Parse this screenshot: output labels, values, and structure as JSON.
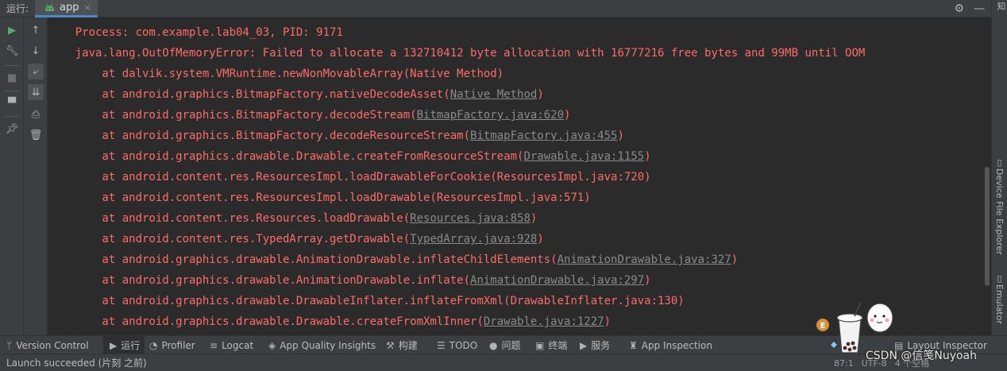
{
  "header": {
    "run_label": "运行:",
    "tab": {
      "label": "app",
      "close": "×"
    },
    "settings_icon": "gear-icon",
    "minimize_icon": "minimize-icon"
  },
  "right_strip": {
    "top_text": "知",
    "device_file_explorer": "Device File Explorer",
    "emulator": "Emulator"
  },
  "toolbar_icons": [
    "run-icon",
    "wrench-icon",
    "stop-icon",
    "layout-icon",
    "pin-icon",
    "up-arrow-icon",
    "down-arrow-icon",
    "soft-wrap-icon",
    "scroll-to-end-icon",
    "print-icon",
    "trash-icon"
  ],
  "console": {
    "lines": [
      {
        "indent": "    ",
        "text": "Process: com.example.lab04_03, PID: 9171",
        "link": "",
        "suffix": ""
      },
      {
        "indent": "    ",
        "text": "java.lang.OutOfMemoryError: Failed to allocate a 132710412 byte allocation with 16777216 free bytes and 99MB until OOM",
        "link": "",
        "suffix": ""
      },
      {
        "indent": "        ",
        "text": "at dalvik.system.VMRuntime.newNonMovableArray(Native Method)",
        "link": "",
        "suffix": ""
      },
      {
        "indent": "        ",
        "text": "at android.graphics.BitmapFactory.nativeDecodeAsset(",
        "link": "Native Method",
        "suffix": ")"
      },
      {
        "indent": "        ",
        "text": "at android.graphics.BitmapFactory.decodeStream(",
        "link": "BitmapFactory.java:620",
        "suffix": ")"
      },
      {
        "indent": "        ",
        "text": "at android.graphics.BitmapFactory.decodeResourceStream(",
        "link": "BitmapFactory.java:455",
        "suffix": ")"
      },
      {
        "indent": "        ",
        "text": "at android.graphics.drawable.Drawable.createFromResourceStream(",
        "link": "Drawable.java:1155",
        "suffix": ")"
      },
      {
        "indent": "        ",
        "text": "at android.content.res.ResourcesImpl.loadDrawableForCookie(ResourcesImpl.java:720)",
        "link": "",
        "suffix": ""
      },
      {
        "indent": "        ",
        "text": "at android.content.res.ResourcesImpl.loadDrawable(ResourcesImpl.java:571)",
        "link": "",
        "suffix": ""
      },
      {
        "indent": "        ",
        "text": "at android.content.res.Resources.loadDrawable(",
        "link": "Resources.java:858",
        "suffix": ")"
      },
      {
        "indent": "        ",
        "text": "at android.content.res.TypedArray.getDrawable(",
        "link": "TypedArray.java:928",
        "suffix": ")"
      },
      {
        "indent": "        ",
        "text": "at android.graphics.drawable.AnimationDrawable.inflateChildElements(",
        "link": "AnimationDrawable.java:327",
        "suffix": ")"
      },
      {
        "indent": "        ",
        "text": "at android.graphics.drawable.AnimationDrawable.inflate(",
        "link": "AnimationDrawable.java:297",
        "suffix": ")"
      },
      {
        "indent": "        ",
        "text": "at android.graphics.drawable.DrawableInflater.inflateFromXml(DrawableInflater.java:130)",
        "link": "",
        "suffix": ""
      },
      {
        "indent": "        ",
        "text": "at android.graphics.drawable.Drawable.createFromXmlInner(",
        "link": "Drawable.java:1227",
        "suffix": ")"
      }
    ]
  },
  "bottom_tools": [
    {
      "icon": "version-control-icon",
      "glyph": "ᛘ",
      "label": "Version Control",
      "active": false
    },
    {
      "icon": "run-icon",
      "glyph": "▶",
      "label": "运行",
      "active": true
    },
    {
      "icon": "profiler-icon",
      "glyph": "◔",
      "label": "Profiler",
      "active": false
    },
    {
      "icon": "logcat-icon",
      "glyph": "≡",
      "label": "Logcat",
      "active": false
    },
    {
      "icon": "app-quality-icon",
      "glyph": "◈",
      "label": "App Quality Insights",
      "active": false
    },
    {
      "icon": "build-icon",
      "glyph": "⚒",
      "label": "构建",
      "active": false
    },
    {
      "icon": "todo-icon",
      "glyph": "☰",
      "label": "TODO",
      "active": false
    },
    {
      "icon": "problems-icon",
      "glyph": "●",
      "label": "问题",
      "active": false
    },
    {
      "icon": "terminal-icon",
      "glyph": "▣",
      "label": "终端",
      "active": false
    },
    {
      "icon": "services-icon",
      "glyph": "▶",
      "label": "服务",
      "active": false
    },
    {
      "icon": "app-inspection-icon",
      "glyph": "♜",
      "label": "App Inspection",
      "active": false
    },
    {
      "icon": "layout-inspector-icon",
      "glyph": "▤",
      "label": "Layout Inspector",
      "active": false
    }
  ],
  "status": {
    "message": "Launch succeeded (片刻 之前)",
    "position": "87:1",
    "encoding": "UTF-8",
    "indent": "4 个空格"
  },
  "watermark": "CSDN @信笺Nuyoah",
  "colors": {
    "error_text": "#ff6b68",
    "link_text": "#8a8a8a",
    "background": "#2b2b2b",
    "panel": "#3c3f41",
    "accent": "#4a88c7",
    "run_green": "#59a869"
  }
}
